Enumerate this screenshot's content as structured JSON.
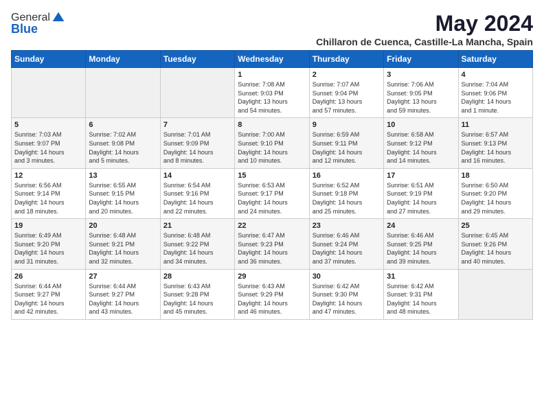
{
  "logo": {
    "general": "General",
    "blue": "Blue"
  },
  "header": {
    "month": "May 2024",
    "location": "Chillaron de Cuenca, Castille-La Mancha, Spain"
  },
  "days_of_week": [
    "Sunday",
    "Monday",
    "Tuesday",
    "Wednesday",
    "Thursday",
    "Friday",
    "Saturday"
  ],
  "weeks": [
    [
      {
        "day": "",
        "info": ""
      },
      {
        "day": "",
        "info": ""
      },
      {
        "day": "",
        "info": ""
      },
      {
        "day": "1",
        "info": "Sunrise: 7:08 AM\nSunset: 9:03 PM\nDaylight: 13 hours\nand 54 minutes."
      },
      {
        "day": "2",
        "info": "Sunrise: 7:07 AM\nSunset: 9:04 PM\nDaylight: 13 hours\nand 57 minutes."
      },
      {
        "day": "3",
        "info": "Sunrise: 7:06 AM\nSunset: 9:05 PM\nDaylight: 13 hours\nand 59 minutes."
      },
      {
        "day": "4",
        "info": "Sunrise: 7:04 AM\nSunset: 9:06 PM\nDaylight: 14 hours\nand 1 minute."
      }
    ],
    [
      {
        "day": "5",
        "info": "Sunrise: 7:03 AM\nSunset: 9:07 PM\nDaylight: 14 hours\nand 3 minutes."
      },
      {
        "day": "6",
        "info": "Sunrise: 7:02 AM\nSunset: 9:08 PM\nDaylight: 14 hours\nand 5 minutes."
      },
      {
        "day": "7",
        "info": "Sunrise: 7:01 AM\nSunset: 9:09 PM\nDaylight: 14 hours\nand 8 minutes."
      },
      {
        "day": "8",
        "info": "Sunrise: 7:00 AM\nSunset: 9:10 PM\nDaylight: 14 hours\nand 10 minutes."
      },
      {
        "day": "9",
        "info": "Sunrise: 6:59 AM\nSunset: 9:11 PM\nDaylight: 14 hours\nand 12 minutes."
      },
      {
        "day": "10",
        "info": "Sunrise: 6:58 AM\nSunset: 9:12 PM\nDaylight: 14 hours\nand 14 minutes."
      },
      {
        "day": "11",
        "info": "Sunrise: 6:57 AM\nSunset: 9:13 PM\nDaylight: 14 hours\nand 16 minutes."
      }
    ],
    [
      {
        "day": "12",
        "info": "Sunrise: 6:56 AM\nSunset: 9:14 PM\nDaylight: 14 hours\nand 18 minutes."
      },
      {
        "day": "13",
        "info": "Sunrise: 6:55 AM\nSunset: 9:15 PM\nDaylight: 14 hours\nand 20 minutes."
      },
      {
        "day": "14",
        "info": "Sunrise: 6:54 AM\nSunset: 9:16 PM\nDaylight: 14 hours\nand 22 minutes."
      },
      {
        "day": "15",
        "info": "Sunrise: 6:53 AM\nSunset: 9:17 PM\nDaylight: 14 hours\nand 24 minutes."
      },
      {
        "day": "16",
        "info": "Sunrise: 6:52 AM\nSunset: 9:18 PM\nDaylight: 14 hours\nand 25 minutes."
      },
      {
        "day": "17",
        "info": "Sunrise: 6:51 AM\nSunset: 9:19 PM\nDaylight: 14 hours\nand 27 minutes."
      },
      {
        "day": "18",
        "info": "Sunrise: 6:50 AM\nSunset: 9:20 PM\nDaylight: 14 hours\nand 29 minutes."
      }
    ],
    [
      {
        "day": "19",
        "info": "Sunrise: 6:49 AM\nSunset: 9:20 PM\nDaylight: 14 hours\nand 31 minutes."
      },
      {
        "day": "20",
        "info": "Sunrise: 6:48 AM\nSunset: 9:21 PM\nDaylight: 14 hours\nand 32 minutes."
      },
      {
        "day": "21",
        "info": "Sunrise: 6:48 AM\nSunset: 9:22 PM\nDaylight: 14 hours\nand 34 minutes."
      },
      {
        "day": "22",
        "info": "Sunrise: 6:47 AM\nSunset: 9:23 PM\nDaylight: 14 hours\nand 36 minutes."
      },
      {
        "day": "23",
        "info": "Sunrise: 6:46 AM\nSunset: 9:24 PM\nDaylight: 14 hours\nand 37 minutes."
      },
      {
        "day": "24",
        "info": "Sunrise: 6:46 AM\nSunset: 9:25 PM\nDaylight: 14 hours\nand 39 minutes."
      },
      {
        "day": "25",
        "info": "Sunrise: 6:45 AM\nSunset: 9:26 PM\nDaylight: 14 hours\nand 40 minutes."
      }
    ],
    [
      {
        "day": "26",
        "info": "Sunrise: 6:44 AM\nSunset: 9:27 PM\nDaylight: 14 hours\nand 42 minutes."
      },
      {
        "day": "27",
        "info": "Sunrise: 6:44 AM\nSunset: 9:27 PM\nDaylight: 14 hours\nand 43 minutes."
      },
      {
        "day": "28",
        "info": "Sunrise: 6:43 AM\nSunset: 9:28 PM\nDaylight: 14 hours\nand 45 minutes."
      },
      {
        "day": "29",
        "info": "Sunrise: 6:43 AM\nSunset: 9:29 PM\nDaylight: 14 hours\nand 46 minutes."
      },
      {
        "day": "30",
        "info": "Sunrise: 6:42 AM\nSunset: 9:30 PM\nDaylight: 14 hours\nand 47 minutes."
      },
      {
        "day": "31",
        "info": "Sunrise: 6:42 AM\nSunset: 9:31 PM\nDaylight: 14 hours\nand 48 minutes."
      },
      {
        "day": "",
        "info": ""
      }
    ]
  ]
}
